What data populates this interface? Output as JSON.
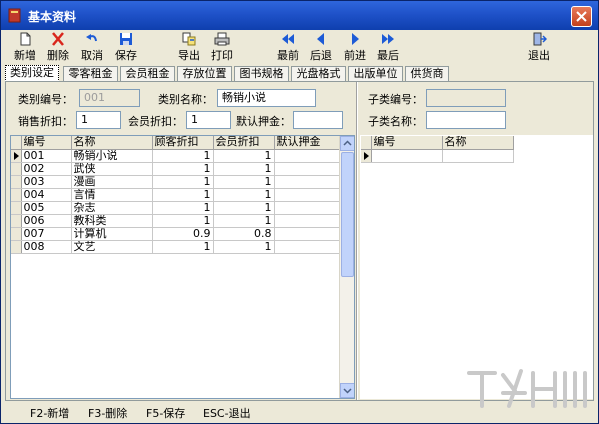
{
  "window": {
    "title": "基本资料"
  },
  "toolbar": [
    {
      "label": "新增",
      "icon": "new-file-icon"
    },
    {
      "label": "删除",
      "icon": "delete-x-icon"
    },
    {
      "label": "取消",
      "icon": "undo-icon"
    },
    {
      "label": "保存",
      "icon": "save-disk-icon"
    },
    {
      "label": "导出",
      "icon": "export-icon"
    },
    {
      "label": "打印",
      "icon": "printer-icon"
    },
    {
      "label": "最前",
      "icon": "first-icon"
    },
    {
      "label": "后退",
      "icon": "prev-icon"
    },
    {
      "label": "前进",
      "icon": "next-icon"
    },
    {
      "label": "最后",
      "icon": "last-icon"
    },
    {
      "label": "退出",
      "icon": "exit-door-icon"
    }
  ],
  "tabs": [
    "类别设定",
    "零客租金",
    "会员租金",
    "存放位置",
    "图书规格",
    "光盘格式",
    "出版单位",
    "供货商"
  ],
  "form": {
    "category_code_label": "类别编号：",
    "category_code_value": "001",
    "category_name_label": "类别名称：",
    "category_name_value": "畅销小说",
    "sale_discount_label": "销售折扣：",
    "sale_discount_value": "1",
    "member_discount_label": "会员折扣：",
    "member_discount_value": "1",
    "default_deposit_label": "默认押金：",
    "default_deposit_value": "",
    "sub_code_label": "子类编号：",
    "sub_code_value": "",
    "sub_name_label": "子类名称：",
    "sub_name_value": ""
  },
  "main_grid": {
    "columns": [
      "编号",
      "名称",
      "顾客折扣",
      "会员折扣",
      "默认押金"
    ],
    "rows": [
      [
        "001",
        "畅销小说",
        "1",
        "1",
        ""
      ],
      [
        "002",
        "武侠",
        "1",
        "1",
        ""
      ],
      [
        "003",
        "漫画",
        "1",
        "1",
        ""
      ],
      [
        "004",
        "言情",
        "1",
        "1",
        ""
      ],
      [
        "005",
        "杂志",
        "1",
        "1",
        ""
      ],
      [
        "006",
        "教科类",
        "1",
        "1",
        ""
      ],
      [
        "007",
        "计算机",
        "0.9",
        "0.8",
        ""
      ],
      [
        "008",
        "文艺",
        "1",
        "1",
        ""
      ]
    ]
  },
  "sub_grid": {
    "columns": [
      "编号",
      "名称"
    ]
  },
  "status": [
    "F2-新增",
    "F3-删除",
    "F5-保存",
    "ESC-退出"
  ],
  "colors": {
    "title_bar": "#1f52c9",
    "accent_blue": "#1d5bd6",
    "delete_red": "#d9261c",
    "frame": "#ece9d8"
  }
}
